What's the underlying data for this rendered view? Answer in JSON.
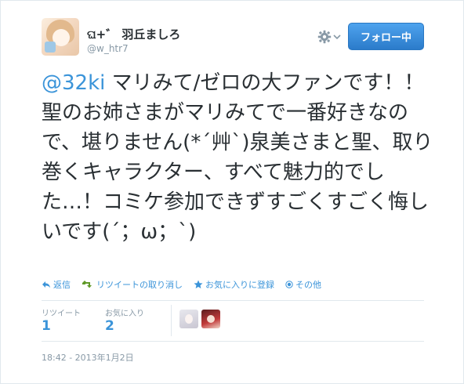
{
  "user": {
    "name": "ଘ+゛ 羽丘ましろ",
    "screen_name": "@w_htr7"
  },
  "header": {
    "follow_button_label": "フォロー中",
    "settings_icon": "gear-icon"
  },
  "tweet": {
    "mention": "@32ki",
    "text": " マリみて/ゼロの大ファンです！！聖のお姉さまがマリみてで一番好きなので、堪りません(*´艸`)泉美さまと聖、取り巻くキャラクター、すべて魅力的でした…！コミケ参加できずすごくすごく悔しいです(´；ω；`)"
  },
  "actions": [
    {
      "label": "返信",
      "icon": "reply-icon"
    },
    {
      "label": "リツイートの取り消し",
      "icon": "retweet-icon"
    },
    {
      "label": "お気に入りに登録",
      "icon": "star-icon"
    },
    {
      "label": "その他",
      "icon": "more-icon"
    }
  ],
  "stats": {
    "retweets_label": "リツイート",
    "retweets_count": "1",
    "favorites_label": "お気に入り",
    "favorites_count": "2"
  },
  "timestamp": "18:42 - 2013年1月2日",
  "colors": {
    "link": "#3b94d9",
    "follow_button": "#2b7bca",
    "muted": "#8899a6"
  }
}
